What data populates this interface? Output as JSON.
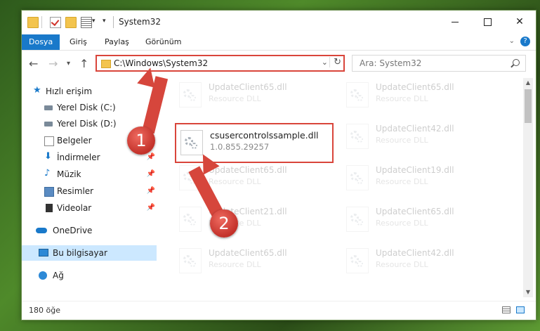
{
  "window": {
    "title": "System32"
  },
  "ribbon": {
    "tabs": [
      "Dosya",
      "Giriş",
      "Paylaş",
      "Görünüm"
    ]
  },
  "nav": {
    "address": "C:\\Windows\\System32",
    "search_placeholder": "Ara: System32"
  },
  "sidebar": {
    "items": [
      {
        "label": "Hızlı erişim",
        "pinned": false
      },
      {
        "label": "Yerel Disk (C:)",
        "pinned": true
      },
      {
        "label": "Yerel Disk (D:)",
        "pinned": true
      },
      {
        "label": "Belgeler",
        "pinned": true
      },
      {
        "label": "İndirmeler",
        "pinned": true
      },
      {
        "label": "Müzik",
        "pinned": true
      },
      {
        "label": "Resimler",
        "pinned": true
      },
      {
        "label": "Videolar",
        "pinned": true
      },
      {
        "label": "OneDrive",
        "pinned": false
      },
      {
        "label": "Bu bilgisayar",
        "pinned": false,
        "selected": true
      },
      {
        "label": "Ağ",
        "pinned": false
      }
    ]
  },
  "files": {
    "left_column": [
      {
        "name": "UpdateClient65.dll",
        "desc": "Resource DLL"
      },
      {
        "name": "csusercontrolssample.dll",
        "desc": "1.0.855.29257",
        "highlighted": true
      },
      {
        "name": "UpdateClient65.dll",
        "desc": "Resource DLL"
      },
      {
        "name": "UpdateClient21.dll",
        "desc": "Resource DLL"
      },
      {
        "name": "UpdateClient65.dll",
        "desc": "Resource DLL"
      }
    ],
    "right_column": [
      {
        "name": "UpdateClient65.dll",
        "desc": "Resource DLL"
      },
      {
        "name": "UpdateClient42.dll",
        "desc": "Resource DLL"
      },
      {
        "name": "UpdateClient19.dll",
        "desc": "Resource DLL"
      },
      {
        "name": "UpdateClient65.dll",
        "desc": "Resource DLL"
      },
      {
        "name": "UpdateClient42.dll",
        "desc": "Resource DLL"
      }
    ]
  },
  "status": {
    "item_count": "180 öğe"
  },
  "callouts": {
    "step1": "1",
    "step2": "2"
  },
  "colors": {
    "accent": "#1979ca",
    "highlight_border": "#d9453b",
    "selection": "#cce8ff"
  }
}
